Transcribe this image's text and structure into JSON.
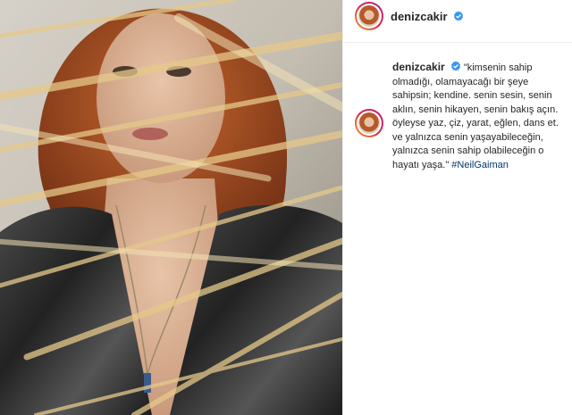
{
  "post": {
    "username": "denizcakir",
    "verified": true,
    "caption": {
      "username": "denizcakir",
      "text": "\"kimsenin sahip olmadığı, olamayacağı bir şeye sahipsin; kendine. senin sesin, senin aklın, senin hikayen, senin bakış açın. öyleyse yaz, çiz, yarat, eğlen, dans et. ve yalnızca senin yaşayabileceğin, yalnızca senin sahip olabileceğin o hayatı yaşa.\"",
      "hashtag": "#NeilGaiman"
    }
  },
  "colors": {
    "verified_blue": "#3897f0",
    "hashtag_blue": "#00376b",
    "hair": "#b65a2a"
  },
  "icons": {
    "verified": "verified-badge-icon"
  }
}
